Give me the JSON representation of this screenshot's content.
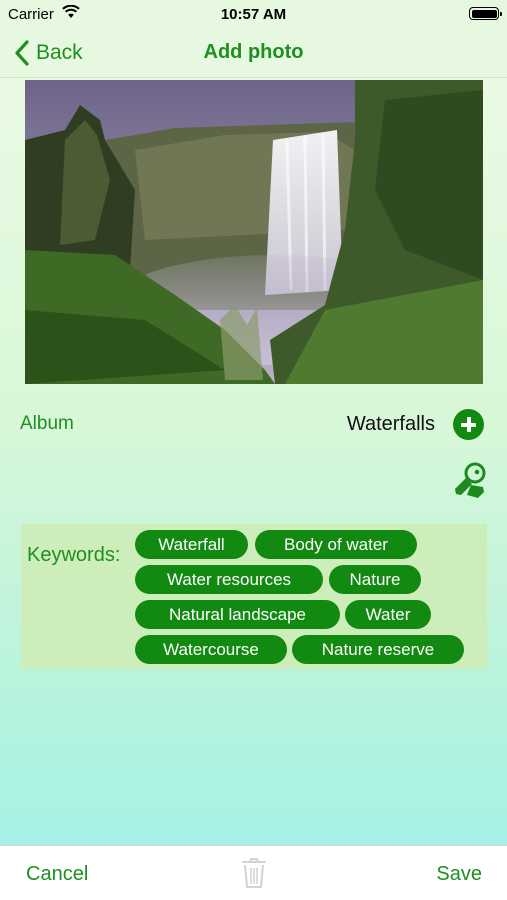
{
  "status_bar": {
    "carrier": "Carrier",
    "time": "10:57 AM",
    "wifi_icon": "wifi-icon",
    "battery_icon": "battery-icon"
  },
  "nav": {
    "back_label": "Back",
    "title": "Add photo"
  },
  "photo": {
    "icon": "waterfall-photo"
  },
  "album": {
    "label": "Album",
    "value": "Waterfalls",
    "add_icon": "plus-circle-icon"
  },
  "keyword_tool_icon": "keyword-tag-icon",
  "keywords": {
    "label": "Keywords:",
    "chips": [
      "Waterfall",
      "Body of water",
      "Water resources",
      "Nature",
      "Natural landscape",
      "Water",
      "Watercourse",
      "Nature reserve",
      "",
      ""
    ]
  },
  "toolbar": {
    "cancel_label": "Cancel",
    "trash_icon": "trash-icon",
    "save_label": "Save"
  },
  "colors": {
    "accent": "#1f8f1f",
    "chip": "#128a12",
    "keywords_bg": "#cdeeba",
    "nav_bg": "#e6f8df"
  }
}
